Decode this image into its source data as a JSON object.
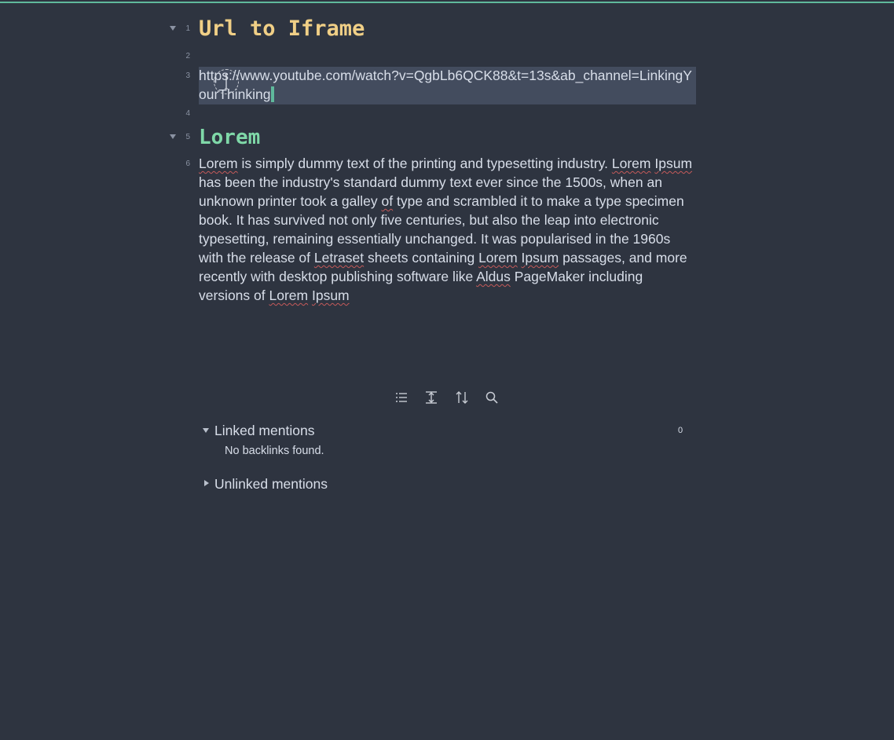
{
  "editor": {
    "lines": [
      {
        "number": "1",
        "type": "heading1",
        "text": "Url to Iframe",
        "foldable": true
      },
      {
        "number": "2",
        "type": "empty",
        "text": ""
      },
      {
        "number": "3",
        "type": "url",
        "text": "https://www.youtube.com/watch?v=QgbLb6QCK88&t=13s&ab_channel=LinkingYourThinking",
        "selected": true
      },
      {
        "number": "4",
        "type": "empty",
        "text": ""
      },
      {
        "number": "5",
        "type": "heading2",
        "text": "Lorem",
        "foldable": true
      },
      {
        "number": "6",
        "type": "paragraph"
      }
    ],
    "paragraph": {
      "w1": "Lorem",
      "t1": " is simply dummy text of the printing and typesetting industry. ",
      "w2": "Lorem",
      "t2": " ",
      "w3": "Ipsum",
      "t3": " has been the industry's standard dummy text ever since the 1500s, when an unknown printer took a galley ",
      "w4": "of",
      "t4": " type and scrambled it to make a type specimen book. It has survived not only five centuries, but also the leap into electronic typesetting, remaining essentially unchanged. It was popularised in the 1960s with the release of ",
      "w5": "Letraset",
      "t5": " sheets containing ",
      "w6": "Lorem",
      "t6": " ",
      "w7": "Ipsum",
      "t7": " passages, and more recently with desktop publishing software like ",
      "w8": "Aldus",
      "t8": " PageMaker including versions of ",
      "w9": "Lorem",
      "t9": " ",
      "w10": "Ipsum"
    }
  },
  "toolbar": {
    "buttons": [
      {
        "icon": "list-icon"
      },
      {
        "icon": "expand-vertical-icon"
      },
      {
        "icon": "sort-icon"
      },
      {
        "icon": "search-icon"
      }
    ]
  },
  "backlinks": {
    "linked": {
      "title": "Linked mentions",
      "count": "0",
      "empty_message": "No backlinks found."
    },
    "unlinked": {
      "title": "Unlinked mentions"
    }
  },
  "colors": {
    "background": "#2e3440",
    "selection": "#434c5e",
    "accent": "#5fb99c",
    "heading1": "#f0cf86",
    "heading2": "#7fd8a8",
    "text": "#d8dee9",
    "gutter": "#8b93a3",
    "spellcheck": "#c55a5a"
  }
}
